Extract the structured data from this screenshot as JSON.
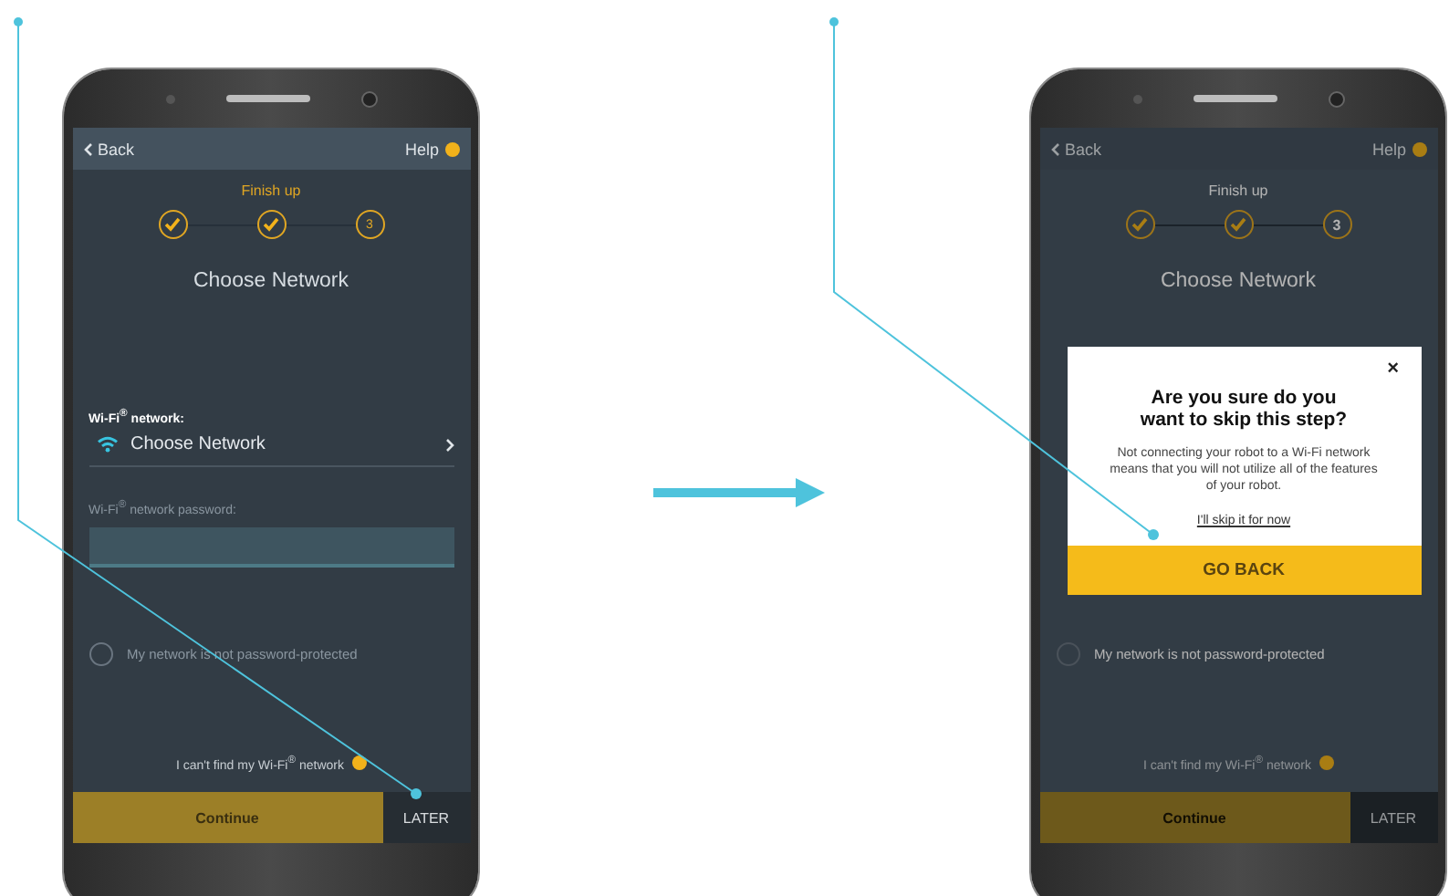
{
  "screens": [
    {
      "dimmed": false,
      "back": "Back",
      "help": "Help",
      "step_title": "Finish up",
      "steps": [
        {
          "done": true
        },
        {
          "done": true
        },
        {
          "done": false,
          "label": "3"
        }
      ],
      "title": "Choose Network",
      "network_label": "Wi-Fi$^{®}$ network:",
      "network_value": "Choose Network",
      "password_label": "Wi-Fi$^{®}$ network password:",
      "no_password": {
        "label": "My network is not password-protected",
        "checked": false
      },
      "help_link": "I can't find my Wi-Fi$^{®}$ network",
      "continue": "Continue",
      "later": "LATER"
    },
    {
      "dimmed": true,
      "back": "Back",
      "help": "Help",
      "step_title": "Finish up",
      "steps": [
        {
          "done": true
        },
        {
          "done": true
        },
        {
          "done": false,
          "label": "3"
        }
      ],
      "title": "Choose Network",
      "no_password": {
        "label": "My network is not password-protected",
        "checked": false
      },
      "help_link": "I can't find my Wi-Fi$^{®}$ network",
      "continue": "Continue",
      "later": "LATER",
      "dialog": {
        "close": "×",
        "title": "Are you sure do you want to skip this step?",
        "message": "Not connecting your robot to a Wi-Fi network means that you will not utilize all of the features of your robot.",
        "link": "I'll skip it for now",
        "button": "GO BACK"
      }
    }
  ]
}
